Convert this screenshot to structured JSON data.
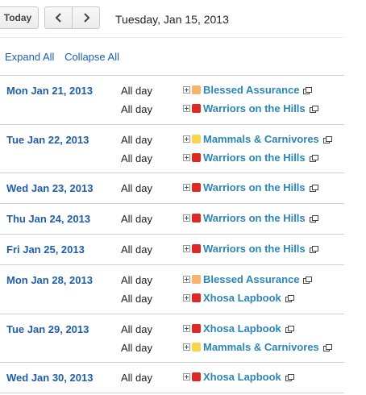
{
  "toolbar": {
    "today_label": "Today",
    "date": "Tuesday, Jan 15, 2013"
  },
  "controls": {
    "expand": "Expand All",
    "collapse": "Collapse All"
  },
  "colors": {
    "orange": "#f7b26c",
    "red": "#dd2a26",
    "yellow": "#f7d64e",
    "link": "#1f5ea8"
  },
  "days": [
    {
      "date": "Mon Jan 21, 2013",
      "events": [
        {
          "time": "All day",
          "title": "Blessed Assurance",
          "color": "#f7b26c"
        },
        {
          "time": "All day",
          "title": "Warriors on the Hills",
          "color": "#dd2a26"
        }
      ]
    },
    {
      "date": "Tue Jan 22, 2013",
      "events": [
        {
          "time": "All day",
          "title": "Mammals & Carnivores",
          "color": "#f7d64e"
        },
        {
          "time": "All day",
          "title": "Warriors on the Hills",
          "color": "#dd2a26"
        }
      ]
    },
    {
      "date": "Wed Jan 23, 2013",
      "events": [
        {
          "time": "All day",
          "title": "Warriors on the Hills",
          "color": "#dd2a26"
        }
      ]
    },
    {
      "date": "Thu Jan 24, 2013",
      "events": [
        {
          "time": "All day",
          "title": "Warriors on the Hills",
          "color": "#dd2a26"
        }
      ]
    },
    {
      "date": "Fri Jan 25, 2013",
      "events": [
        {
          "time": "All day",
          "title": "Warriors on the Hills",
          "color": "#dd2a26"
        }
      ]
    },
    {
      "date": "Mon Jan 28, 2013",
      "events": [
        {
          "time": "All day",
          "title": "Blessed Assurance",
          "color": "#f7b26c"
        },
        {
          "time": "All day",
          "title": "Xhosa Lapbook",
          "color": "#dd2a26"
        }
      ]
    },
    {
      "date": "Tue Jan 29, 2013",
      "events": [
        {
          "time": "All day",
          "title": "Xhosa Lapbook",
          "color": "#dd2a26"
        },
        {
          "time": "All day",
          "title": "Mammals & Carnivores",
          "color": "#f7d64e"
        }
      ]
    },
    {
      "date": "Wed Jan 30, 2013",
      "events": [
        {
          "time": "All day",
          "title": "Xhosa Lapbook",
          "color": "#dd2a26"
        }
      ]
    }
  ]
}
